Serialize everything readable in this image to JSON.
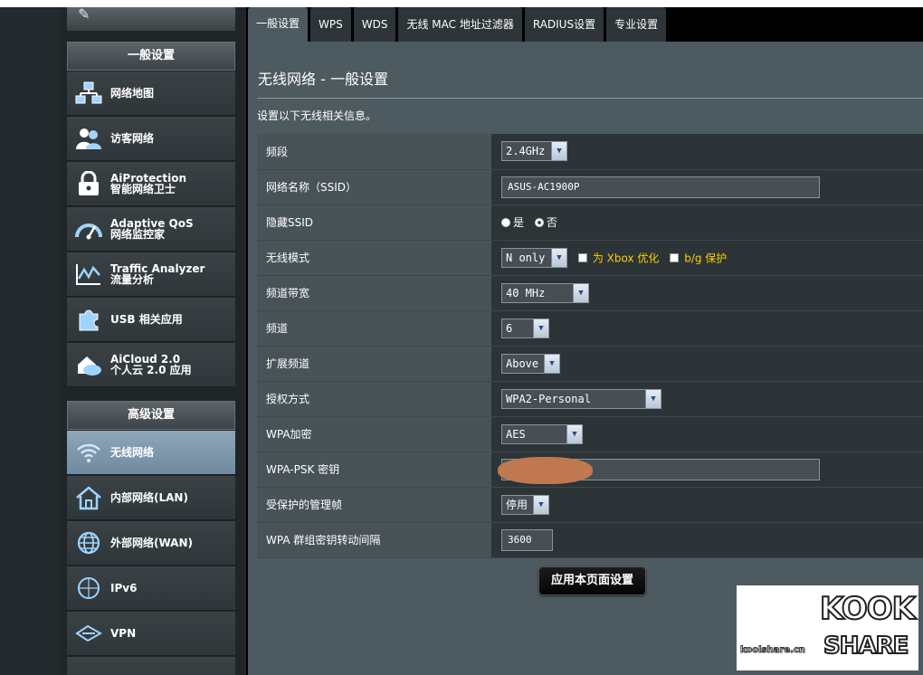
{
  "tabs": [
    {
      "label": "一般设置",
      "active": true
    },
    {
      "label": "WPS"
    },
    {
      "label": "WDS"
    },
    {
      "label": "无线 MAC 地址过滤器"
    },
    {
      "label": "RADIUS设置"
    },
    {
      "label": "专业设置"
    }
  ],
  "menu": {
    "general_header": "一般设置",
    "general_items": [
      {
        "line1": "网络地图",
        "line2": "",
        "icon": "network-map-icon"
      },
      {
        "line1": "访客网络",
        "line2": "",
        "icon": "guest-network-icon"
      },
      {
        "line1": "AiProtection",
        "line2": "智能网络卫士",
        "icon": "lock-icon"
      },
      {
        "line1": "Adaptive QoS",
        "line2": "网络监控家",
        "icon": "gauge-icon"
      },
      {
        "line1": "Traffic Analyzer",
        "line2": "流量分析",
        "icon": "traffic-chart-icon"
      },
      {
        "line1": "USB 相关应用",
        "line2": "",
        "icon": "puzzle-icon"
      },
      {
        "line1": "AiCloud 2.0",
        "line2": "个人云 2.0 应用",
        "icon": "cloud-house-icon"
      }
    ],
    "advanced_header": "高级设置",
    "advanced_items": [
      {
        "line1": "无线网络",
        "line2": "",
        "icon": "wifi-icon",
        "active": true
      },
      {
        "line1": "内部网络(LAN)",
        "line2": "",
        "icon": "home-icon"
      },
      {
        "line1": "外部网络(WAN)",
        "line2": "",
        "icon": "globe-icon"
      },
      {
        "line1": "IPv6",
        "line2": "",
        "icon": "ipv6-globe-icon"
      },
      {
        "line1": "VPN",
        "line2": "",
        "icon": "vpn-icon"
      }
    ]
  },
  "page": {
    "title": "无线网络 - 一般设置",
    "description": "设置以下无线相关信息。",
    "apply_label": "应用本页面设置"
  },
  "settings": {
    "band": {
      "label": "频段",
      "value": "2.4GHz"
    },
    "ssid": {
      "label": "网络名称（SSID）",
      "value": "ASUS-AC1900P"
    },
    "hide_ssid": {
      "label": "隐藏SSID",
      "yes": "是",
      "no": "否",
      "selected": "no"
    },
    "mode": {
      "label": "无线模式",
      "value": "N only",
      "xbox_label": "为 Xbox 优化",
      "bg_label": "b/g 保护"
    },
    "bandwidth": {
      "label": "频道带宽",
      "value": "40 MHz"
    },
    "channel": {
      "label": "频道",
      "value": "6"
    },
    "ext_channel": {
      "label": "扩展频道",
      "value": "Above"
    },
    "auth": {
      "label": "授权方式",
      "value": "WPA2-Personal"
    },
    "wpa_enc": {
      "label": "WPA加密",
      "value": "AES"
    },
    "psk": {
      "label": "WPA-PSK 密钥",
      "value": ""
    },
    "pmf": {
      "label": "受保护的管理帧",
      "value": "停用"
    },
    "gtk_interval": {
      "label": "WPA 群组密钥转动间隔",
      "value": "3600"
    }
  },
  "watermark": {
    "brand_top": "KOOK",
    "brand_bottom": "SHARE",
    "url": "koolshare.cn"
  },
  "colors": {
    "content_bg": "#4d5a60",
    "label_bg": "#485358",
    "value_bg": "#2c3438",
    "highlight": "#ffcc00",
    "active_menu": "#7f99ad"
  }
}
